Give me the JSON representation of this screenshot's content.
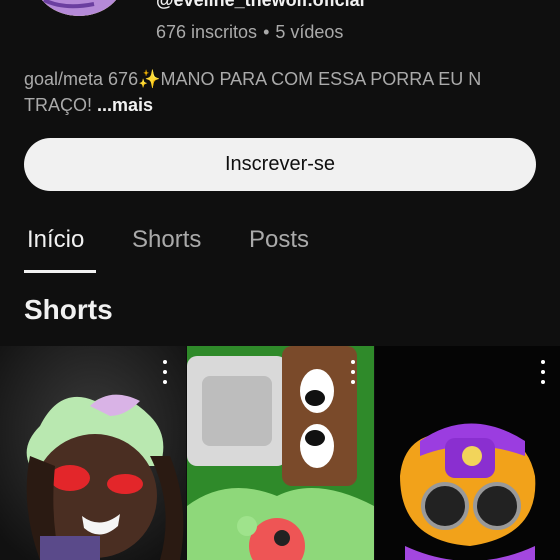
{
  "channel": {
    "handle": "@eveline_thewolf.oficial",
    "subscribers": "676 inscritos",
    "separator": "•",
    "videos": "5 vídeos",
    "description": "goal/meta 676✨MANO PARA COM ESSA PORRA EU N",
    "description_line2": "TRAÇO! ",
    "more_label": "...mais"
  },
  "subscribe_label": "Inscrever-se",
  "tabs": [
    {
      "label": "Início",
      "active": true
    },
    {
      "label": "Shorts",
      "active": false
    },
    {
      "label": "Posts",
      "active": false
    }
  ],
  "section_title": "Shorts",
  "shorts": [
    {
      "thumb": "dark character with red eyes and mint hair"
    },
    {
      "thumb": "green background with cartoon characters"
    },
    {
      "thumb": "purple character with round goggles"
    }
  ],
  "colors": {
    "background": "#0f0f0f",
    "primary_text": "#f1f1f1",
    "secondary_text": "#aaaaaa",
    "button_bg": "#f1f1f1"
  }
}
